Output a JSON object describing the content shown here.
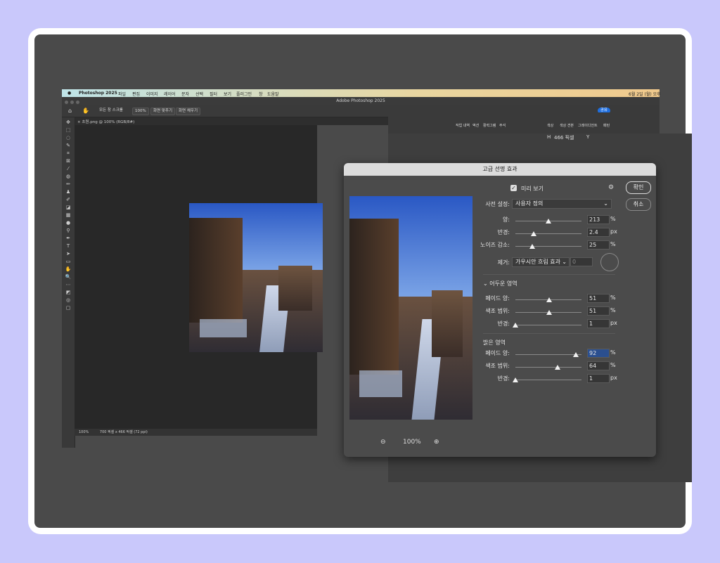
{
  "app": {
    "menubar": [
      "Photoshop 2025",
      "파일",
      "편집",
      "이미지",
      "레이어",
      "문자",
      "선택",
      "필터",
      "보기",
      "플러그인",
      "창",
      "도움말"
    ],
    "clock": "6월 2일 (월) 오후",
    "window_title": "Adobe Photoshop 2025",
    "options": {
      "all_windows": "모든 창 스크롤",
      "zoom": "100%",
      "fit_screen": "화면 맞추기",
      "fill_screen": "화면 채우기",
      "share": "공유"
    },
    "doc_tab": "× 초원.png @ 100% (RGB/8#)",
    "status": {
      "zoom": "100%",
      "info": "700 픽셀 x 466 픽셀 (72 ppi)"
    },
    "right_tabs": [
      "작업 내역",
      "액션",
      "활력그램",
      "주석"
    ],
    "prop_tabs": [
      "색상",
      "색상 견본",
      "그레이디언트",
      "패턴"
    ],
    "prop_h": "H",
    "prop_h_val": "466 픽셀",
    "prop_y": "Y"
  },
  "dialog": {
    "title": "고급 선명 효과",
    "preview_label": "미리 보기",
    "ok": "확인",
    "cancel": "취소",
    "preset_label": "사전 설정:",
    "preset_value": "사용자 정의",
    "amount": {
      "label": "양:",
      "value": "213",
      "unit": "%",
      "fraction": 0.5
    },
    "radius": {
      "label": "반경:",
      "value": "2.4",
      "unit": "px",
      "fraction": 0.28
    },
    "noise": {
      "label": "노이즈 감소:",
      "value": "25",
      "unit": "%",
      "fraction": 0.25
    },
    "remove_label": "제거:",
    "remove_value": "가우시안 흐림 효과",
    "angle_value": "0",
    "shadows": {
      "title": "어두운 영역",
      "fade": {
        "label": "페이드 양:",
        "value": "51",
        "unit": "%",
        "fraction": 0.51
      },
      "tonal": {
        "label": "색조 범위:",
        "value": "51",
        "unit": "%",
        "fraction": 0.51
      },
      "radius": {
        "label": "반경:",
        "value": "1",
        "unit": "px",
        "fraction": 0.0
      }
    },
    "highlights": {
      "title": "밝은 영역",
      "fade": {
        "label": "페이드 양:",
        "value": "92",
        "unit": "%",
        "fraction": 0.92
      },
      "tonal": {
        "label": "색조 범위:",
        "value": "64",
        "unit": "%",
        "fraction": 0.64
      },
      "radius": {
        "label": "반경:",
        "value": "1",
        "unit": "px",
        "fraction": 0.0
      }
    },
    "zoom_level": "100%"
  }
}
